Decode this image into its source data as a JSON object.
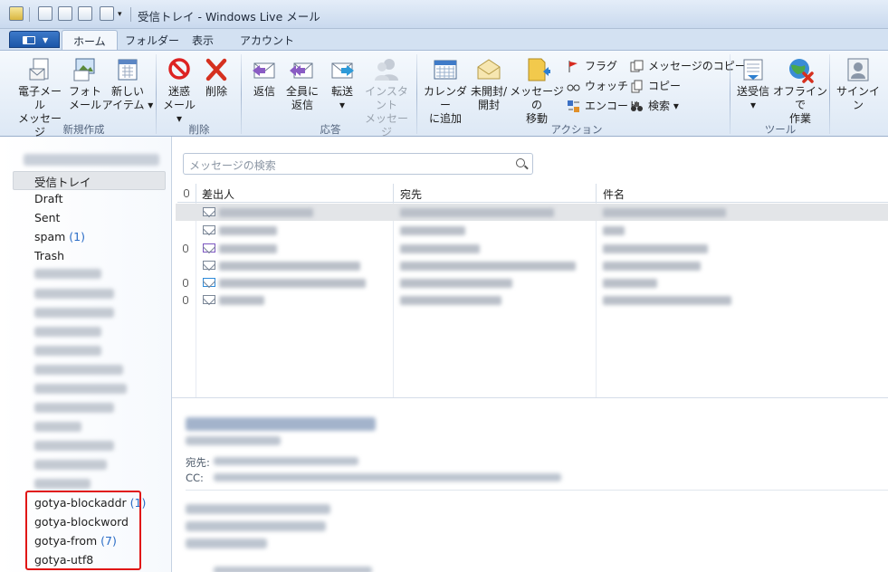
{
  "window": {
    "title": "受信トレイ - Windows Live メール"
  },
  "tabs": [
    {
      "label": "ホーム"
    },
    {
      "label": "フォルダー"
    },
    {
      "label": "表示"
    },
    {
      "label": "アカウント"
    }
  ],
  "ribbon": {
    "new_group": {
      "label": "新規作成",
      "email_line1": "電子メール",
      "email_line2": "メッセージ",
      "photo_line1": "フォト",
      "photo_line2": "メール",
      "newitem_line1": "新しい",
      "newitem_line2": "アイテム ▾"
    },
    "delete_group": {
      "label": "削除",
      "junk_line1": "迷惑",
      "junk_line2": "メール ▾",
      "delete": "削除"
    },
    "respond_group": {
      "label": "応答",
      "reply": "返信",
      "replyall_line1": "全員に",
      "replyall_line2": "返信",
      "forward": "転送",
      "forward_arrow": "▾",
      "im_line1": "インスタント",
      "im_line2": "メッセージ"
    },
    "actions_group": {
      "label": "アクション",
      "calendar_line1": "カレンダー",
      "calendar_line2": "に追加",
      "unread_line1": "未開封/",
      "unread_line2": "開封",
      "move_line1": "メッセージの",
      "move_line2": "移動",
      "flag": "フラグ",
      "watch": "ウォッチ",
      "encode": "エンコード",
      "copy_message": "メッセージのコピー",
      "copy": "コピー",
      "find": "検索 ▾"
    },
    "tools_group": {
      "label": "ツール",
      "sendrecv_line1": "送受信",
      "sendrecv_arrow": "▾",
      "offline_line1": "オフラインで",
      "offline_line2": "作業"
    },
    "signin": "サインイン"
  },
  "folders": {
    "inbox": "受信トレイ",
    "draft": "Draft",
    "sent": "Sent",
    "spam": "spam",
    "spam_count": "(1)",
    "trash": "Trash",
    "blockaddr": "gotya-blockaddr",
    "blockaddr_count": "(1)",
    "blockword": "gotya-blockword",
    "from": "gotya-from",
    "from_count": "(7)",
    "utf8": "gotya-utf8"
  },
  "search": {
    "placeholder": "メッセージの検索"
  },
  "columns": {
    "from": "差出人",
    "to": "宛先",
    "subject": "件名"
  },
  "preview": {
    "to_label": "宛先:",
    "cc_label": "CC:"
  },
  "colors": {
    "accent": "#1b56a8",
    "highlight_box": "#e01616",
    "count": "#2a6cc6"
  }
}
